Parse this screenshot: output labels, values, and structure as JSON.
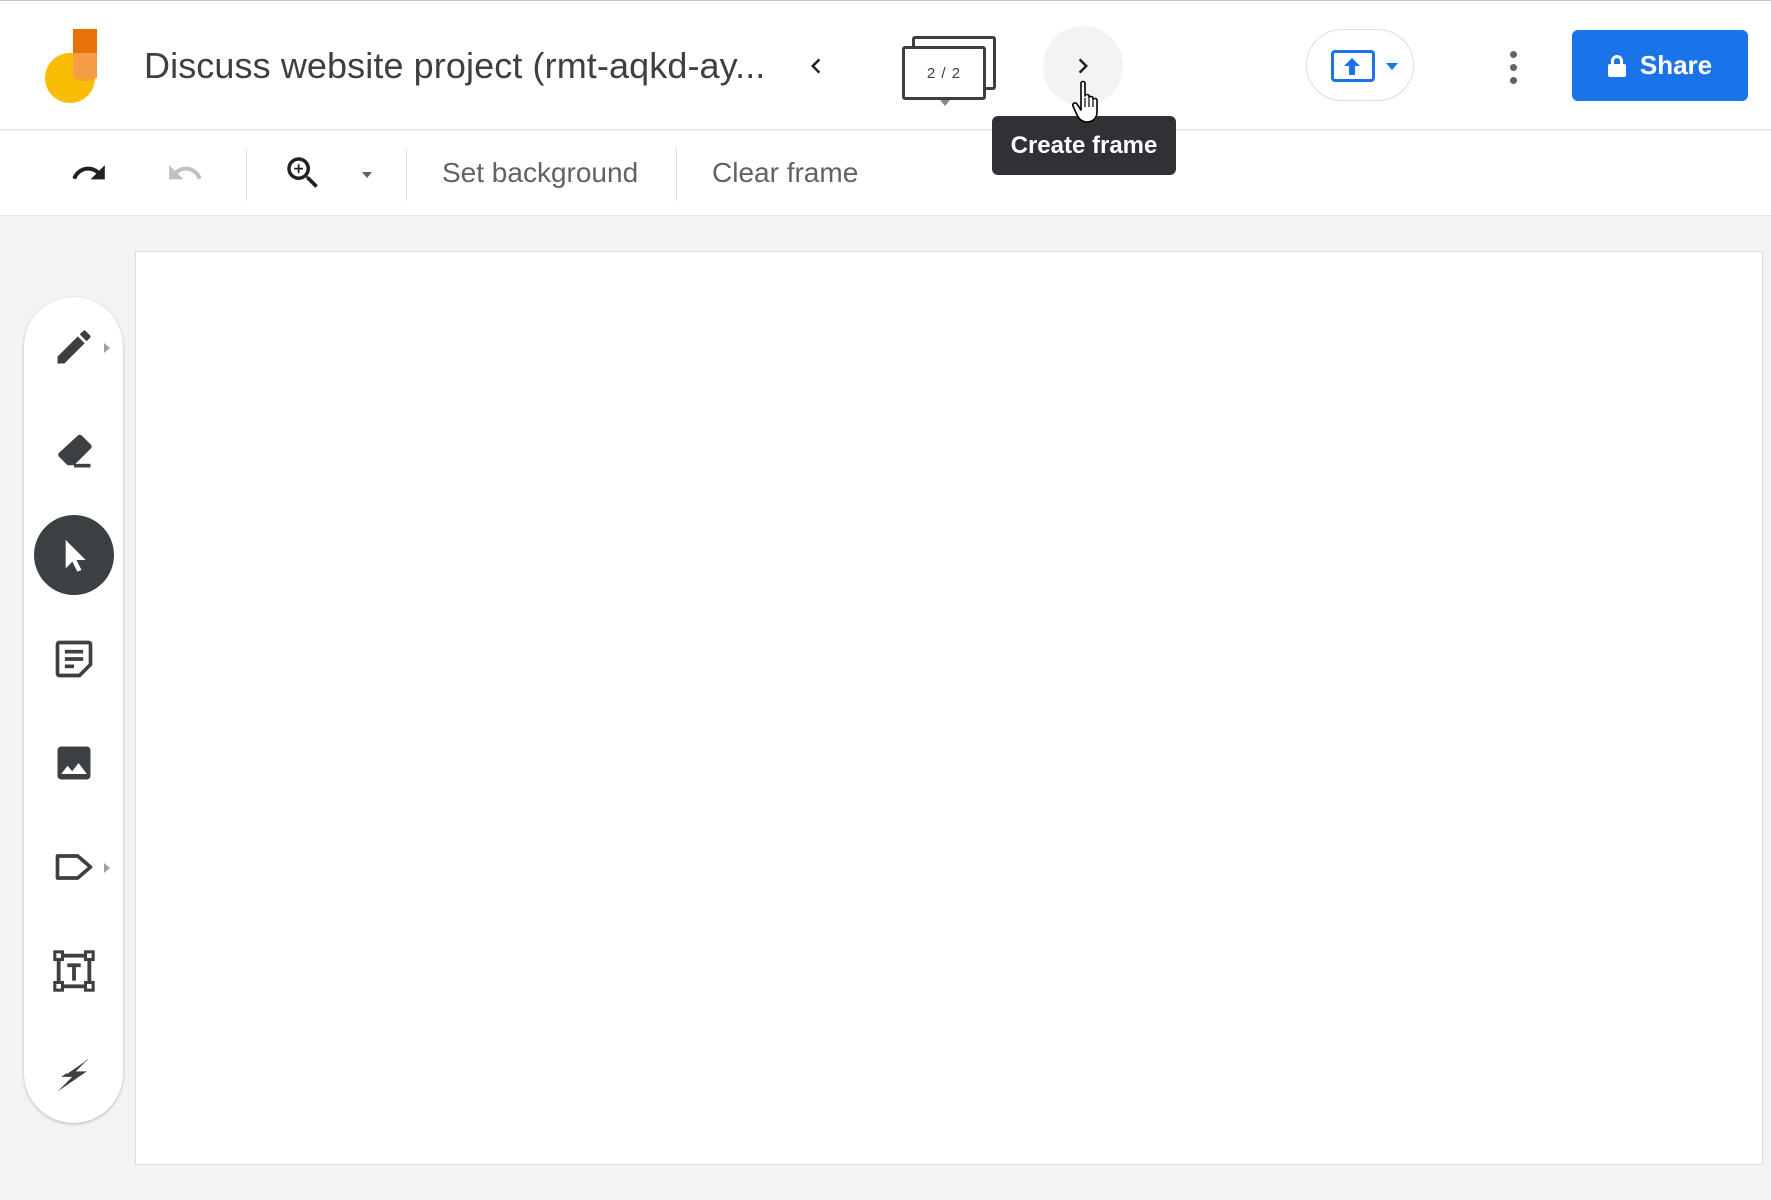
{
  "header": {
    "title": "Discuss website project (rmt-aqkd-ay...",
    "frame_counter": "2 / 2",
    "share_label": "Share"
  },
  "icons": {
    "logo": "jamboard-logo",
    "prev": "chevron-left-icon",
    "next": "chevron-right-icon",
    "present": "present-icon",
    "more": "more-vert-icon",
    "lock": "lock-icon"
  },
  "toolbar": {
    "set_background_label": "Set background",
    "clear_frame_label": "Clear frame"
  },
  "tooltip": {
    "text": "Create frame"
  },
  "tools": [
    {
      "name": "pen",
      "icon": "pen-icon",
      "active": false
    },
    {
      "name": "eraser",
      "icon": "eraser-icon",
      "active": false
    },
    {
      "name": "select",
      "icon": "pointer-icon",
      "active": true
    },
    {
      "name": "sticky-note",
      "icon": "sticky-note-icon",
      "active": false
    },
    {
      "name": "image",
      "icon": "image-icon",
      "active": false
    },
    {
      "name": "shape",
      "icon": "shape-icon",
      "active": false
    },
    {
      "name": "text-box",
      "icon": "text-box-icon",
      "active": false
    },
    {
      "name": "laser",
      "icon": "laser-icon",
      "active": false
    }
  ],
  "colors": {
    "accent": "#1a73e8",
    "logo_orange": "#e8710a",
    "logo_yellow": "#fbbc04",
    "tooltip_bg": "#303134"
  }
}
